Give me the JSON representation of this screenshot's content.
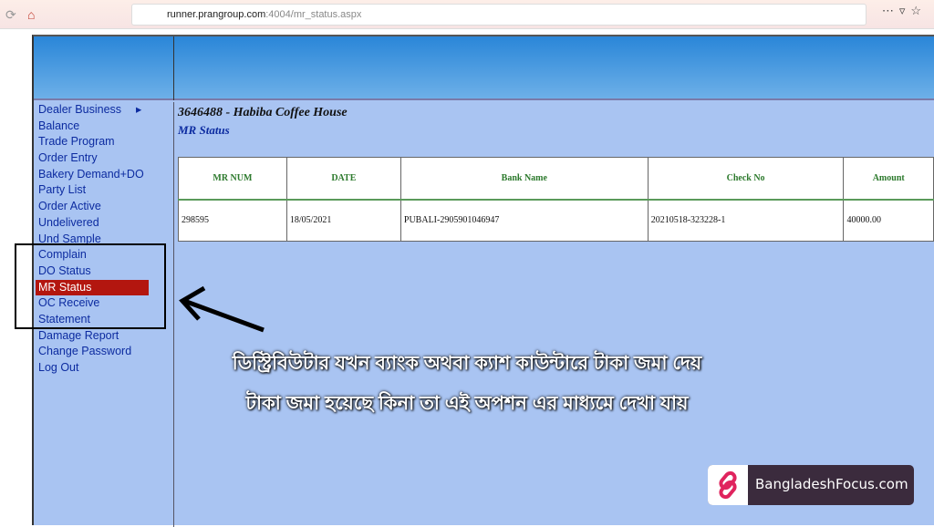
{
  "browser": {
    "url_host": "runner.prangroup.com",
    "url_rest": ":4004/mr_status.aspx"
  },
  "sidebar": {
    "items": [
      "Dealer Business",
      "Balance",
      "Trade Program",
      "Order Entry",
      "Bakery Demand+DO",
      "Party List",
      "Order Active",
      "Undelivered",
      "Und Sample",
      "Complain",
      "DO Status",
      "MR Status",
      "OC Receive",
      "Statement",
      "Damage Report",
      "Change Password",
      "Log Out"
    ],
    "active": "MR Status"
  },
  "main": {
    "title": "3646488  - Habiba Coffee House",
    "subtitle": "MR Status",
    "table": {
      "headers": [
        "MR NUM",
        "DATE",
        "Bank Name",
        "Check No",
        "Amount"
      ],
      "rows": [
        [
          "298595",
          "18/05/2021",
          "PUBALI-2905901046947",
          "20210518-323228-1",
          "40000.00"
        ]
      ]
    }
  },
  "overlay": {
    "line1": "ডিস্ট্রিবিউটার যখন ব্যাংক অথবা ক্যাশ কাউন্টারে টাকা জমা দেয়",
    "line2": "টাকা জমা হয়েছে কিনা তা এই অপশন এর মাধ্যমে দেখা যায়"
  },
  "watermark": {
    "text": "BangladeshFocus.com",
    "color": "#e0245e"
  }
}
